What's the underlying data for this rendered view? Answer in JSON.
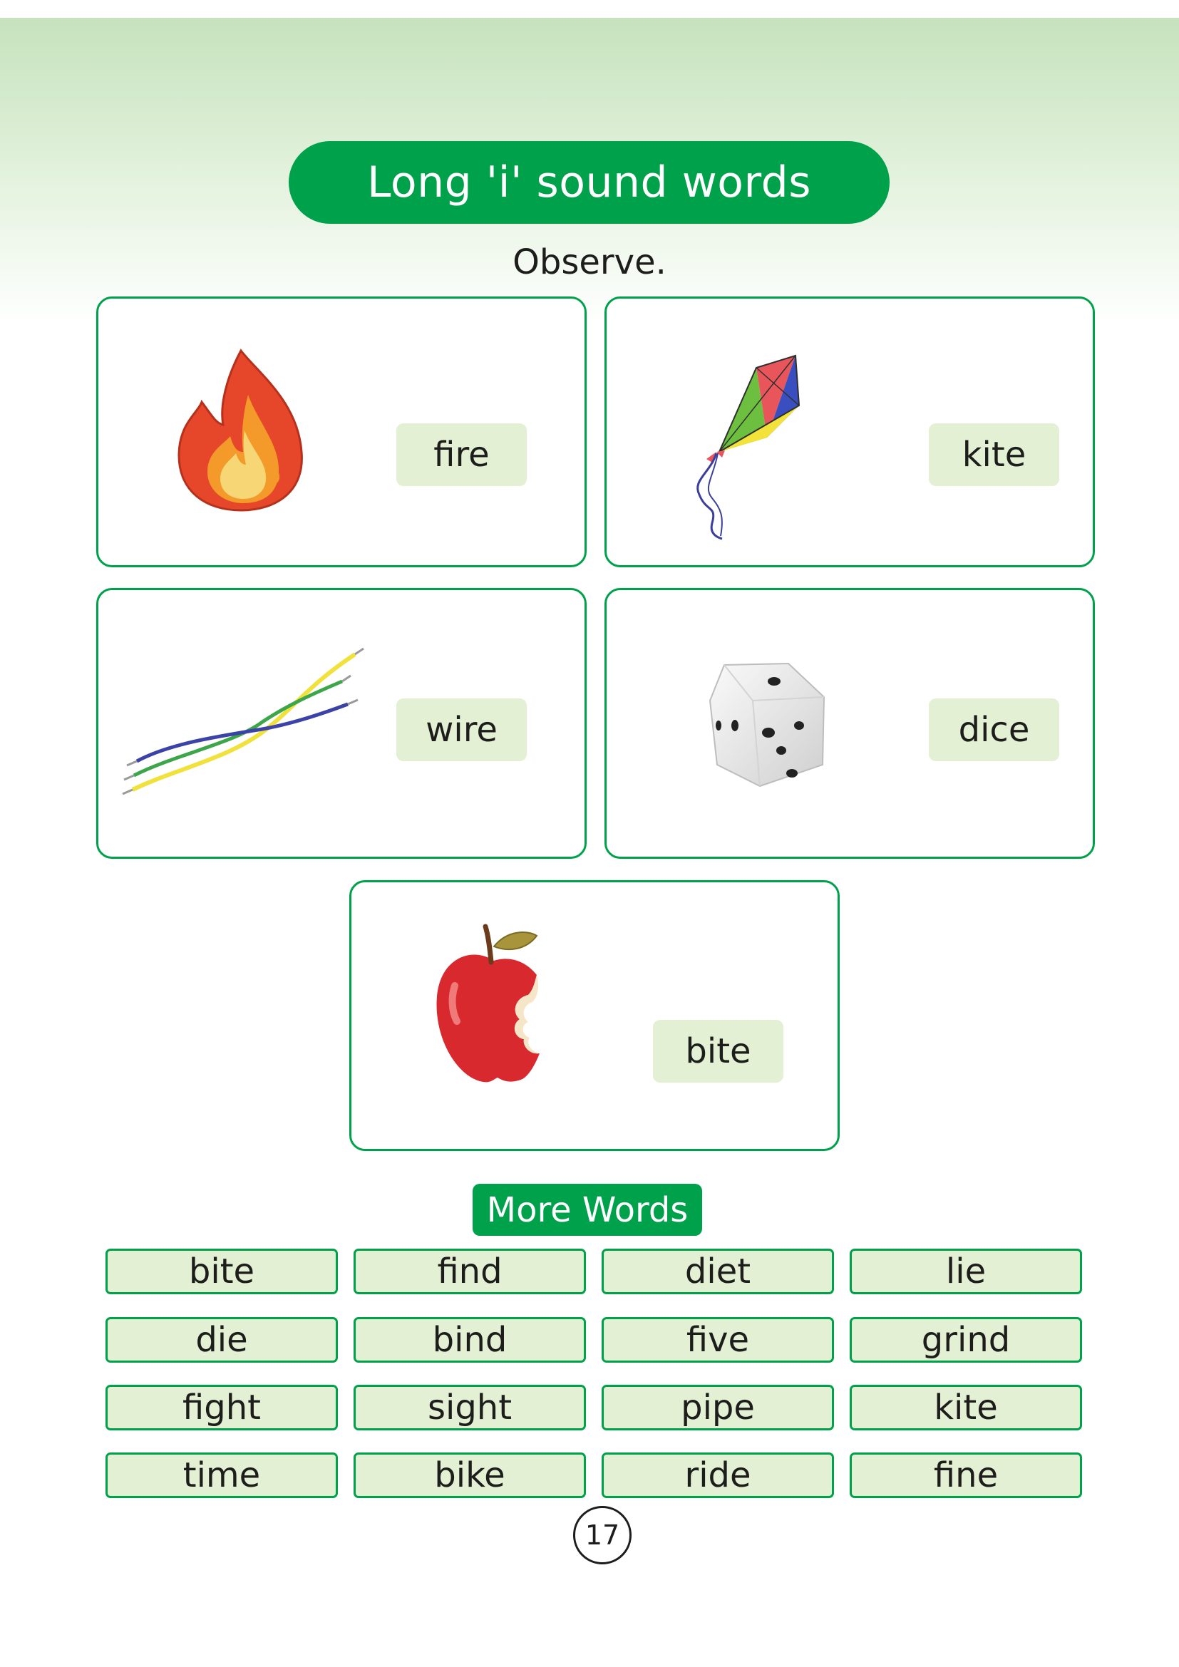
{
  "header": {
    "title": "Long 'i' sound words"
  },
  "instruction": "Observe.",
  "cards": [
    {
      "word": "fire",
      "icon": "fire-icon"
    },
    {
      "word": "kite",
      "icon": "kite-icon"
    },
    {
      "word": "wire",
      "icon": "wires-icon"
    },
    {
      "word": "dice",
      "icon": "dice-icon"
    },
    {
      "word": "bite",
      "icon": "bitten-apple-icon"
    }
  ],
  "more_words": {
    "label": "More Words",
    "rows": [
      [
        "bite",
        "find",
        "diet",
        "lie"
      ],
      [
        "die",
        "bind",
        "five",
        "grind"
      ],
      [
        "fight",
        "sight",
        "pipe",
        "kite"
      ],
      [
        "time",
        "bike",
        "ride",
        "fine"
      ]
    ]
  },
  "page_number": "17",
  "colors": {
    "accent": "#00a14b",
    "chip": "#e3f0d3",
    "band": "#c6e2bd"
  }
}
